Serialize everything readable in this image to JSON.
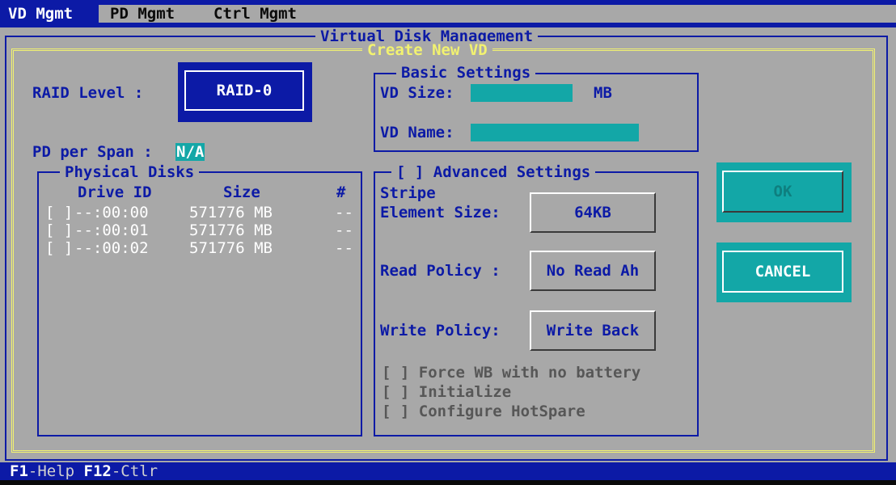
{
  "menu": {
    "vd_mgmt": "VD Mgmt",
    "pd_mgmt": "PD Mgmt",
    "ctrl_mgmt": "Ctrl Mgmt"
  },
  "window": {
    "title": "Virtual Disk Management",
    "dialog_title": "Create New VD"
  },
  "raid": {
    "label": "RAID Level :",
    "value": "RAID-0"
  },
  "pd_per_span": {
    "label": "PD per Span :",
    "value": "N/A"
  },
  "physical_disks": {
    "title": "Physical Disks",
    "headers": [
      "Drive ID",
      "Size",
      "#"
    ],
    "rows": [
      {
        "check": "[ ]",
        "id": "--:00:00",
        "size": "571776 MB",
        "num": "--"
      },
      {
        "check": "[ ]",
        "id": "--:00:01",
        "size": "571776 MB",
        "num": "--"
      },
      {
        "check": "[ ]",
        "id": "--:00:02",
        "size": "571776 MB",
        "num": "--"
      }
    ]
  },
  "basic": {
    "title": "Basic Settings",
    "size_label": "VD Size:",
    "size_unit": "MB",
    "size_value": "",
    "name_label": "VD Name:",
    "name_value": ""
  },
  "advanced": {
    "title": "[ ] Advanced Settings",
    "stripe_label_1": "Stripe",
    "stripe_label_2": "Element Size:",
    "stripe_value": "64KB",
    "read_label": "Read Policy :",
    "read_value": "No Read Ah",
    "write_label": "Write Policy:",
    "write_value": "Write Back",
    "opt_force": "[ ] Force WB with no battery",
    "opt_init": "[ ] Initialize",
    "opt_hotspare": "[ ] Configure HotSpare"
  },
  "buttons": {
    "ok": "OK",
    "cancel": "CANCEL"
  },
  "statusbar": {
    "f1": "F1",
    "help": "-Help ",
    "f12": "F12",
    "ctlr": "-Ctlr"
  },
  "colors": {
    "blue": "#0c1aa6",
    "gray": "#a8a8a8",
    "cyan": "#13a7a7",
    "yellow": "#f2f270"
  }
}
